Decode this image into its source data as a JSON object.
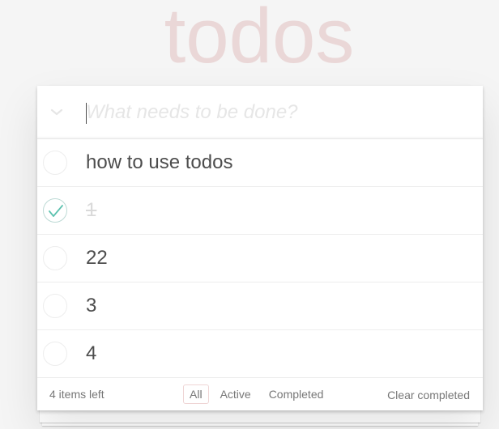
{
  "app": {
    "title": "todos"
  },
  "new_todo": {
    "placeholder": "What needs to be done?",
    "value": ""
  },
  "todos": [
    {
      "label": "how to use todos",
      "completed": false
    },
    {
      "label": "1",
      "completed": true
    },
    {
      "label": "22",
      "completed": false
    },
    {
      "label": "3",
      "completed": false
    },
    {
      "label": "4",
      "completed": false
    }
  ],
  "footer": {
    "count_text": "4 items left",
    "filters": [
      {
        "label": "All",
        "selected": true
      },
      {
        "label": "Active",
        "selected": false
      },
      {
        "label": "Completed",
        "selected": false
      }
    ],
    "clear_label": "Clear completed"
  },
  "colors": {
    "title": "#eac8c8",
    "check": "#5dc2af",
    "text": "#4d4d4d",
    "muted": "#777777",
    "completed_text": "#d9d9d9"
  },
  "icons": {
    "toggle_all": "chevron-down-icon",
    "check": "check-icon"
  }
}
